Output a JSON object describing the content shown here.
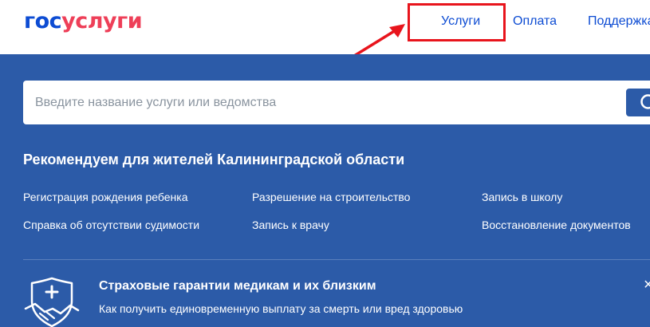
{
  "header": {
    "logo": {
      "part1": "гос",
      "part2": "услуги"
    },
    "nav": {
      "services": "Услуги",
      "payment": "Оплата",
      "support": "Поддержка"
    }
  },
  "search": {
    "placeholder": "Введите название услуги или ведомства",
    "value": ""
  },
  "recommend": {
    "title": "Рекомендуем для жителей Калининградской области",
    "links": [
      "Регистрация рождения ребенка",
      "Разрешение на строительство",
      "Запись в школу",
      "Справка об отсутствии судимости",
      "Запись к врачу",
      "Восстановление документов"
    ]
  },
  "banner": {
    "title": "Страховые гарантии медикам и их близким",
    "text": "Как получить единовременную выплату за смерть или вред здоровью",
    "close": "×"
  },
  "colors": {
    "brand_blue": "#0d4cd3",
    "brand_red": "#ee3f58",
    "panel_blue": "#2c5ba8",
    "annotation_red": "#e8141c"
  },
  "icons": {
    "search": "search-icon",
    "banner": "medical-shield-handshake-icon",
    "close": "close-icon",
    "annotation": "red-arrow-annotation"
  }
}
